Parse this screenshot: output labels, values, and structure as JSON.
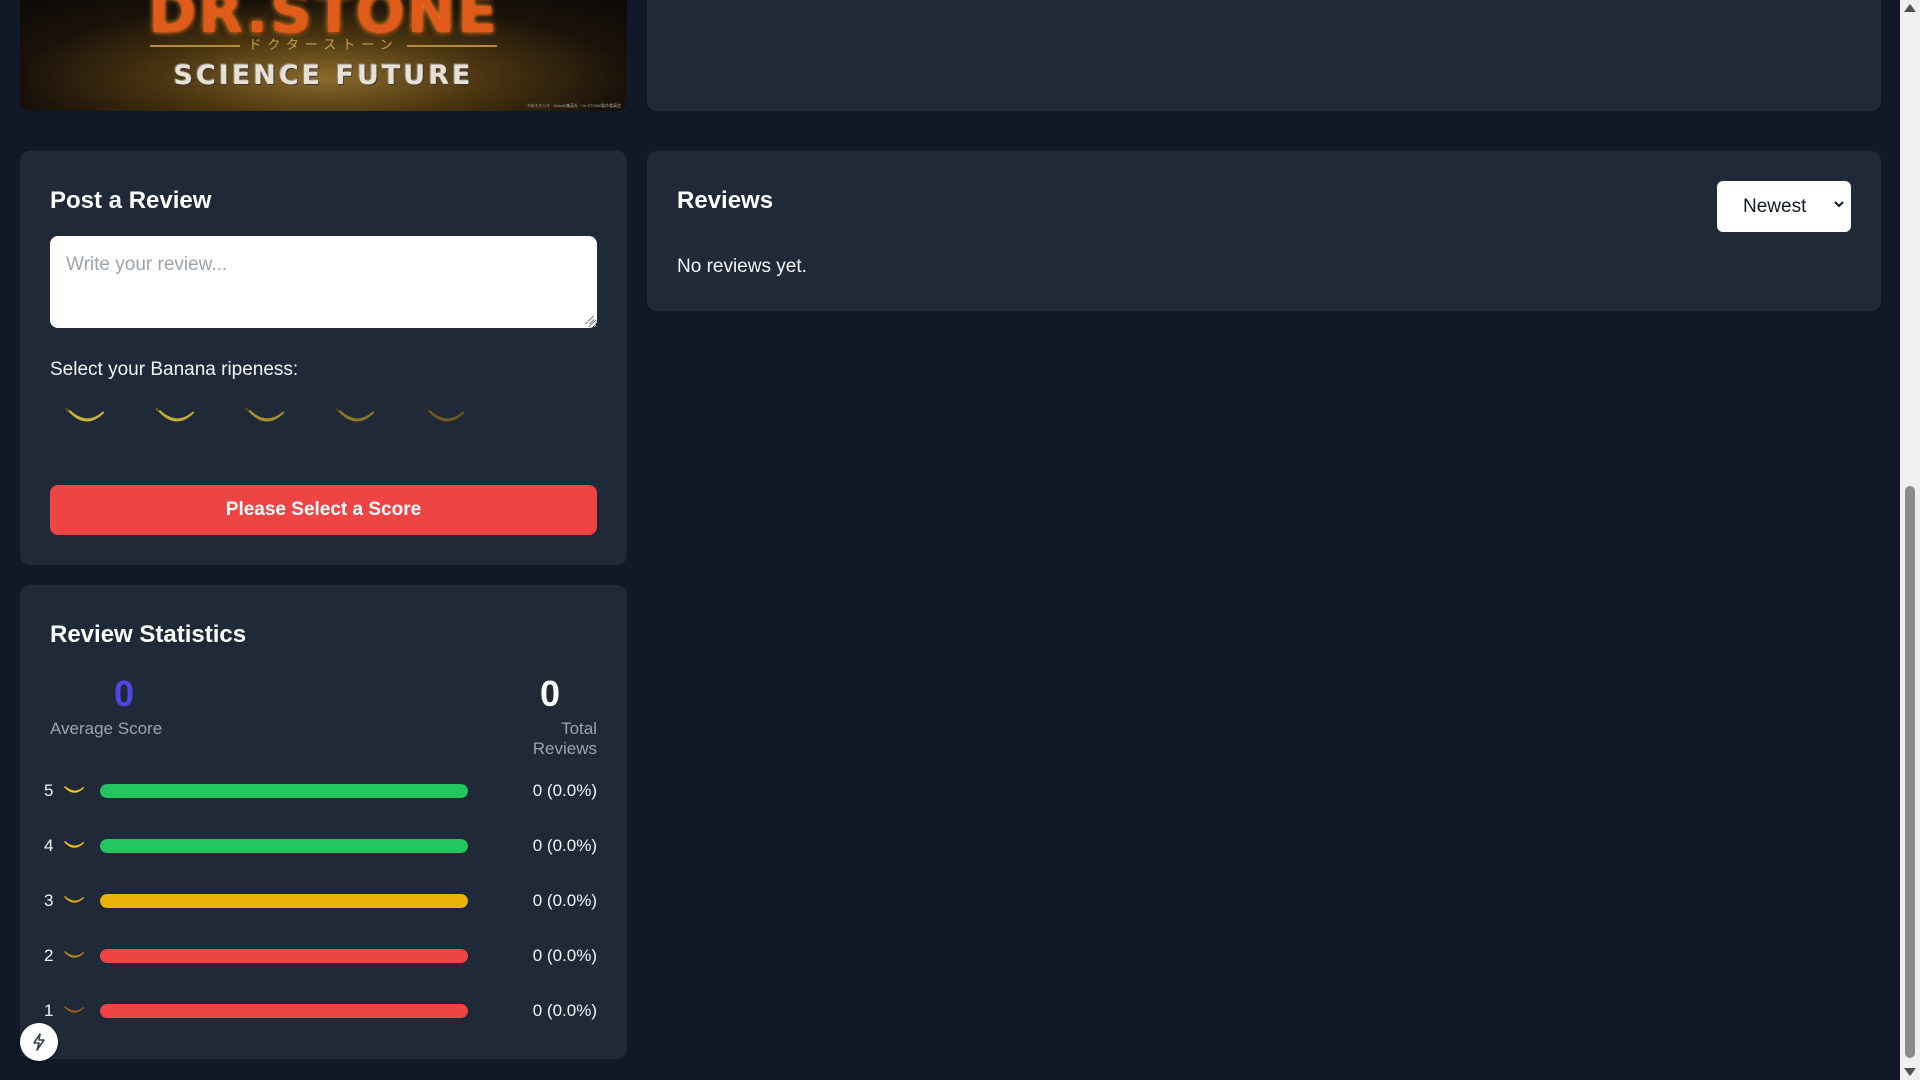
{
  "banner": {
    "title_art": "DR.STONE",
    "subtitle_art": "ドクターストーン",
    "tagline": "SCIENCE FUTURE",
    "copyright": "©米スタジオ・Boichi/集英社・Dr.STONE製作委員会"
  },
  "post_review": {
    "title": "Post a Review",
    "placeholder": "Write your review...",
    "ripeness_label": "Select your Banana ripeness:",
    "banana_options": [
      1,
      2,
      3,
      4,
      5
    ],
    "submit_label": "Please Select a Score"
  },
  "stats": {
    "title": "Review Statistics",
    "average_score": "0",
    "average_label": "Average Score",
    "total_reviews": "0",
    "total_label": "Total Reviews",
    "distribution": [
      {
        "score": "5",
        "count_text": "0 (0.0%)",
        "fill": 1.0,
        "color": "#22c55e",
        "banana_color": "#facc15"
      },
      {
        "score": "4",
        "count_text": "0 (0.0%)",
        "fill": 1.0,
        "color": "#22c55e",
        "banana_color": "#f5c518"
      },
      {
        "score": "3",
        "count_text": "0 (0.0%)",
        "fill": 1.0,
        "color": "#eab308",
        "banana_color": "#d9a916"
      },
      {
        "score": "2",
        "count_text": "0 (0.0%)",
        "fill": 1.0,
        "color": "#ef4444",
        "banana_color": "#b8861a"
      },
      {
        "score": "1",
        "count_text": "0 (0.0%)",
        "fill": 1.0,
        "color": "#ef4444",
        "banana_color": "#8a6418"
      }
    ]
  },
  "reviews": {
    "title": "Reviews",
    "sort_value": "Newest",
    "empty_text": "No reviews yet."
  },
  "colors": {
    "page_bg": "#111827",
    "card_bg": "#1f2937",
    "accent": "#4f46e5",
    "danger": "#ef4444"
  },
  "icons": {
    "banana": "banana-icon",
    "sort_chevron": "chevron-down-icon",
    "fab": "lightning-icon"
  }
}
